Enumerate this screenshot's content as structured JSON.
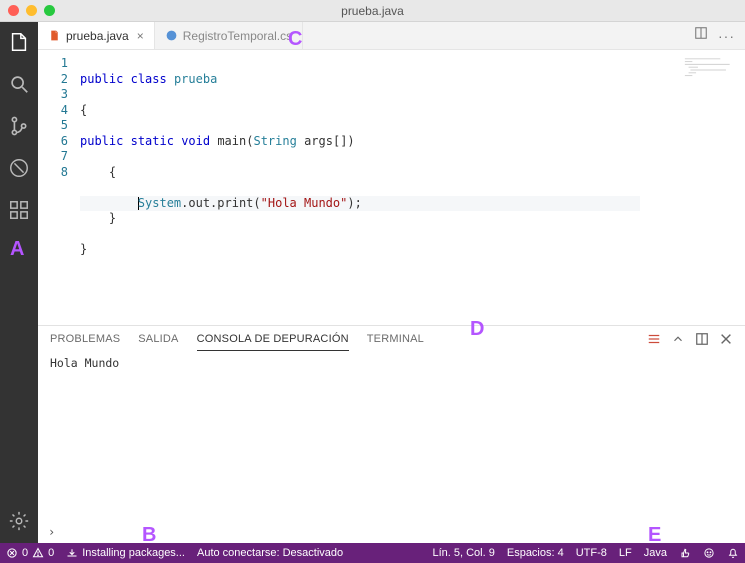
{
  "window": {
    "title": "prueba.java"
  },
  "tabs": [
    {
      "label": "prueba.java",
      "icon": "java",
      "active": true
    },
    {
      "label": "RegistroTemporal.cs",
      "icon": "cs",
      "active": false
    }
  ],
  "editor": {
    "lines": [
      "1",
      "2",
      "3",
      "4",
      "5",
      "6",
      "7",
      "8"
    ],
    "code": {
      "l1a": "public",
      "l1b": "class",
      "l1c": "prueba",
      "l2": "{",
      "l3a": "public",
      "l3b": "static",
      "l3c": "void",
      "l3d": "main",
      "l3e": "(",
      "l3f": "String",
      "l3g": "args",
      "l3h": "[])",
      "l4": "    {",
      "l5a": "        ",
      "l5b": "System",
      "l5c": ".out.print(",
      "l5d": "\"Hola Mundo\"",
      "l5e": ");",
      "l6": "    }",
      "l7": "}"
    }
  },
  "panel": {
    "tabs": {
      "problemas": "PROBLEMAS",
      "salida": "SALIDA",
      "consola": "CONSOLA DE DEPURACIÓN",
      "terminal": "TERMINAL"
    },
    "output": "Hola Mundo"
  },
  "statusbar": {
    "errors": "0",
    "warnings": "0",
    "installing": "Installing packages...",
    "autoconnect": "Auto conectarse: Desactivado",
    "lineCol": "Lín. 5, Col. 9",
    "spaces": "Espacios: 4",
    "encoding": "UTF-8",
    "eol": "LF",
    "lang": "Java"
  },
  "overlays": {
    "A": "A",
    "B": "B",
    "C": "C",
    "D": "D",
    "E": "E"
  }
}
